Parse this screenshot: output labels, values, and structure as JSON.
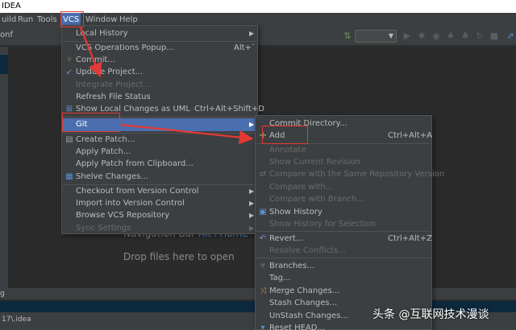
{
  "window": {
    "title": "IDEA"
  },
  "menubar": {
    "items": [
      {
        "label": "uild"
      },
      {
        "label": "Run"
      },
      {
        "label": "Tools"
      },
      {
        "label": "VCS"
      },
      {
        "label": "Window"
      },
      {
        "label": "Help"
      }
    ],
    "active": "VCS"
  },
  "toolbar": {
    "left_text": "onf"
  },
  "editor": {
    "navigation_hint": "Navigation Bar",
    "navigation_shortcut": "Alt+Home",
    "drop_hint": "Drop files here to open"
  },
  "bottom": {
    "left_text": "g",
    "status_path": "17\\.idea"
  },
  "vcs_menu": {
    "items": [
      {
        "label": "Local History",
        "submenu": true
      },
      {
        "label": "VCS Operations Popup...",
        "shortcut": "Alt+`"
      },
      {
        "label": "Commit...",
        "icon": "commit-icon"
      },
      {
        "label": "Update Project...",
        "icon": "update-icon"
      },
      {
        "label": "Integrate Project...",
        "disabled": true
      },
      {
        "label": "Refresh File Status"
      },
      {
        "label": "Show Local Changes as UML",
        "shortcut": "Ctrl+Alt+Shift+D",
        "icon": "uml-icon"
      },
      {
        "label": "Git",
        "submenu": true,
        "selected": true
      },
      {
        "label": "Create Patch...",
        "icon": "patch-icon"
      },
      {
        "label": "Apply Patch..."
      },
      {
        "label": "Apply Patch from Clipboard..."
      },
      {
        "label": "Shelve Changes...",
        "icon": "shelve-icon"
      },
      {
        "label": "Checkout from Version Control",
        "submenu": true
      },
      {
        "label": "Import into Version Control",
        "submenu": true
      },
      {
        "label": "Browse VCS Repository",
        "submenu": true
      },
      {
        "label": "Sync Settings",
        "submenu": true,
        "disabled": true
      }
    ]
  },
  "git_menu": {
    "items": [
      {
        "label": "Commit Directory..."
      },
      {
        "label": "Add",
        "shortcut": "Ctrl+Alt+A",
        "icon": "add-icon"
      },
      {
        "label": "Annotate",
        "disabled": true
      },
      {
        "label": "Show Current Revision",
        "disabled": true
      },
      {
        "label": "Compare with the Same Repository Version",
        "disabled": true
      },
      {
        "label": "Compare with...",
        "disabled": true
      },
      {
        "label": "Compare with Branch...",
        "disabled": true
      },
      {
        "label": "Show History",
        "icon": "history-icon"
      },
      {
        "label": "Show History for Selection",
        "disabled": true
      },
      {
        "label": "Revert...",
        "shortcut": "Ctrl+Alt+Z",
        "icon": "revert-icon"
      },
      {
        "label": "Resolve Conflicts...",
        "disabled": true
      },
      {
        "label": "Branches...",
        "icon": "branches-icon"
      },
      {
        "label": "Tag..."
      },
      {
        "label": "Merge Changes...",
        "icon": "merge-icon"
      },
      {
        "label": "Stash Changes..."
      },
      {
        "label": "UnStash Changes..."
      },
      {
        "label": "Reset HEAD...",
        "icon": "reset-icon"
      }
    ]
  },
  "watermark": "头条 @互联网技术漫谈",
  "colors": {
    "menu_bg": "#3c3f41",
    "selection": "#4b6eaf",
    "annotation": "#e53935",
    "disabled_text": "#6b6b6b",
    "editor_bg": "#2b2b2b"
  }
}
